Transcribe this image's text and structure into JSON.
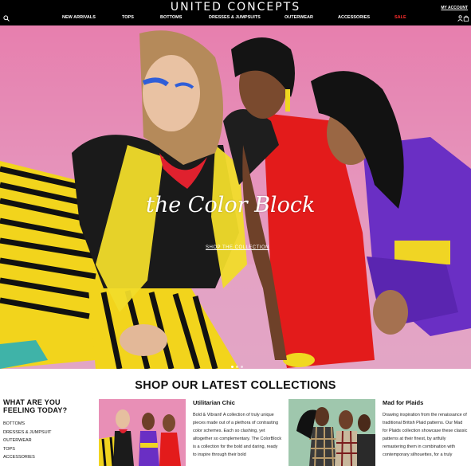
{
  "header": {
    "logo": "UNITED CONCEPTS",
    "my_account": "MY ACCOUNT",
    "nav": [
      {
        "label": "NEW ARRIVALS"
      },
      {
        "label": "TOPS"
      },
      {
        "label": "BOTTOMS"
      },
      {
        "label": "DRESSES & JUMPSUITS"
      },
      {
        "label": "OUTERWEAR"
      },
      {
        "label": "ACCESSORIES"
      },
      {
        "label": "SALE"
      }
    ],
    "icons": [
      "search-icon",
      "user-icon",
      "cart-icon"
    ]
  },
  "hero": {
    "title": "the Color Block",
    "cta": "SHOP THE COLLECTION",
    "slides": 3,
    "active_slide": 1
  },
  "collections": {
    "title": "SHOP OUR LATEST COLLECTIONS",
    "feeling": {
      "title": "WHAT ARE YOU FEELING TODAY?",
      "items": [
        "BOTTOMS",
        "DRESSES & JUMPSUIT",
        "OUTERWEAR",
        "TOPS",
        "ACCESSORIES"
      ]
    },
    "cards": [
      {
        "title": "Utilitarian Chic",
        "description": "Bold & Vibrant! A collection of truly unique pieces made out of a plethora of contrasting color schemes. Each so clashing, yet altogether so complementary. The ColorBlock is a collection for the bold and daring, ready to inspire through their bold"
      },
      {
        "title": "Mad for Plaids",
        "description": "Drawing inspiration from the renaissance of traditional British Plaid patterns. Our Mad for Plaids collection showcase these classic patterns at their finest, by artfully remastering them in combination with contemporary silhouettes, for a truly"
      }
    ]
  },
  "colors": {
    "header_bg": "#000000",
    "sale": "#ff2d2d",
    "hero_bg": "#e77fae"
  }
}
